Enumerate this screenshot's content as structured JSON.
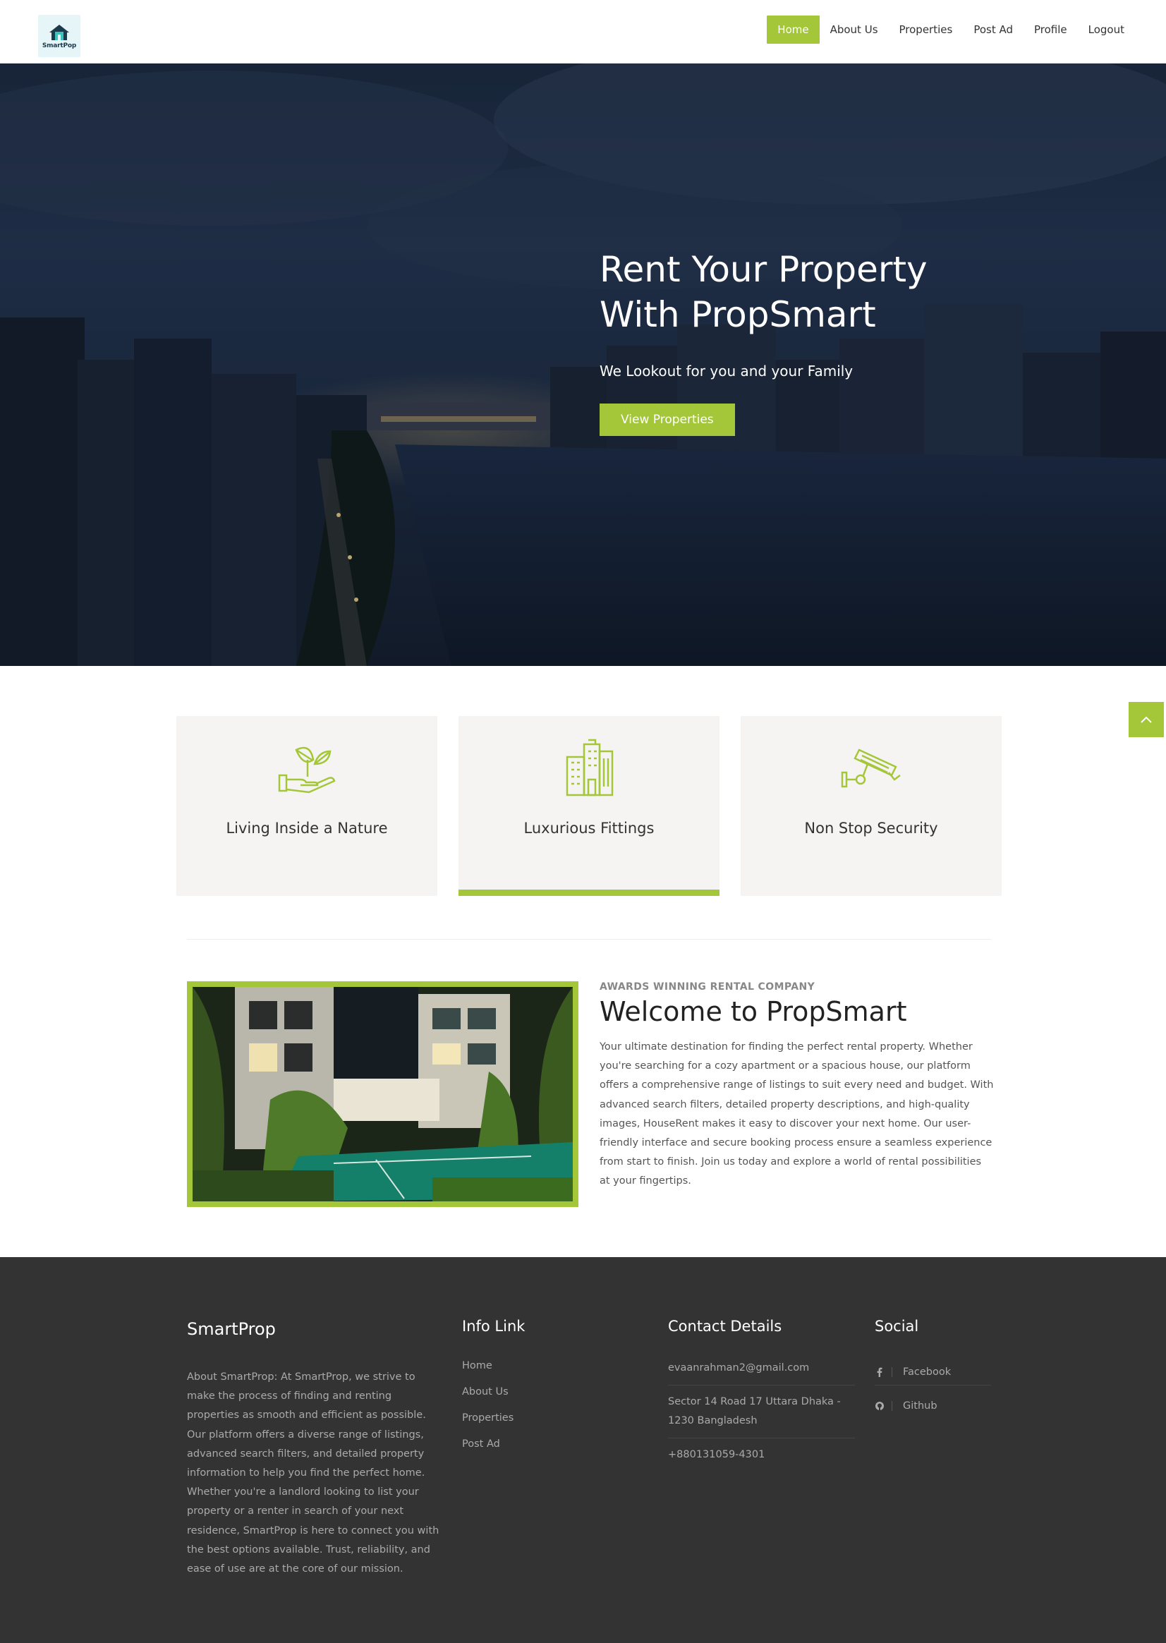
{
  "brand": {
    "logo_text": "SmartPop",
    "accent_color": "#a4c639"
  },
  "nav": {
    "items": [
      {
        "label": "Home",
        "active": true
      },
      {
        "label": "About Us",
        "active": false
      },
      {
        "label": "Properties",
        "active": false
      },
      {
        "label": "Post Ad",
        "active": false
      },
      {
        "label": "Profile",
        "active": false
      },
      {
        "label": "Logout",
        "active": false
      }
    ]
  },
  "hero": {
    "title_line1": "Rent Your Property",
    "title_line2": "With PropSmart",
    "subtitle": "We Lookout for you and your Family",
    "button_label": "View Properties"
  },
  "features": [
    {
      "title": "Living Inside a Nature",
      "icon": "leaf-hand-icon"
    },
    {
      "title": "Luxurious Fittings",
      "icon": "buildings-icon"
    },
    {
      "title": "Non Stop Security",
      "icon": "security-camera-icon"
    }
  ],
  "about": {
    "kicker": "AWARDS WINNING RENTAL COMPANY",
    "title": "Welcome to PropSmart",
    "text": "Your ultimate destination for finding the perfect rental property. Whether you're searching for a cozy apartment or a spacious house, our platform offers a comprehensive range of listings to suit every need and budget. With advanced search filters, detailed property descriptions, and high-quality images, HouseRent makes it easy to discover your next home. Our user-friendly interface and secure booking process ensure a seamless experience from start to finish. Join us today and explore a world of rental possibilities at your fingertips."
  },
  "footer": {
    "brand": "SmartProp",
    "about_text": "About SmartProp: At SmartProp, we strive to make the process of finding and renting properties as smooth and efficient as possible. Our platform offers a diverse range of listings, advanced search filters, and detailed property information to help you find the perfect home. Whether you're a landlord looking to list your property or a renter in search of your next residence, SmartProp is here to connect you with the best options available. Trust, reliability, and ease of use are at the core of our mission.",
    "info_heading": "Info Link",
    "info_links": [
      "Home",
      "About Us",
      "Properties",
      "Post Ad"
    ],
    "contact_heading": "Contact Details",
    "contact": {
      "email": "evaanrahman2@gmail.com",
      "address": "Sector 14 Road 17 Uttara Dhaka - 1230 Bangladesh",
      "phone": "+880131059-4301"
    },
    "social_heading": "Social",
    "social": [
      {
        "label": "Facebook",
        "icon": "facebook-icon"
      },
      {
        "label": "Github",
        "icon": "github-icon"
      }
    ]
  }
}
